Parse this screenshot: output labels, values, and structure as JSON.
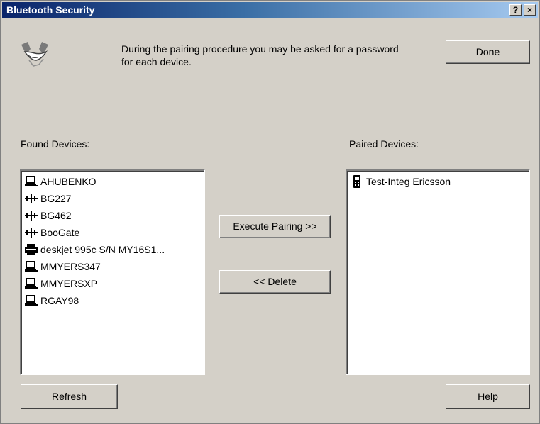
{
  "window": {
    "title": "Bluetooth Security",
    "help_btn": "?",
    "close_btn": "×"
  },
  "info_text": "During the pairing procedure you may be asked for a password for each device.",
  "buttons": {
    "done": "Done",
    "execute_pairing": "Execute Pairing >>",
    "delete": "<< Delete",
    "refresh": "Refresh",
    "help": "Help"
  },
  "found_devices": {
    "label": "Found Devices:",
    "items": [
      {
        "name": "AHUBENKO",
        "icon": "computer-icon"
      },
      {
        "name": "BG227",
        "icon": "network-icon"
      },
      {
        "name": "BG462",
        "icon": "network-icon"
      },
      {
        "name": "BooGate",
        "icon": "network-icon"
      },
      {
        "name": "deskjet 995c S/N MY16S1...",
        "icon": "printer-icon"
      },
      {
        "name": "MMYERS347",
        "icon": "computer-icon"
      },
      {
        "name": "MMYERSXP",
        "icon": "computer-icon"
      },
      {
        "name": "RGAY98",
        "icon": "computer-icon"
      }
    ]
  },
  "paired_devices": {
    "label": "Paired Devices:",
    "items": [
      {
        "name": "Test-Integ Ericsson",
        "icon": "mobile-phone-icon"
      }
    ]
  }
}
